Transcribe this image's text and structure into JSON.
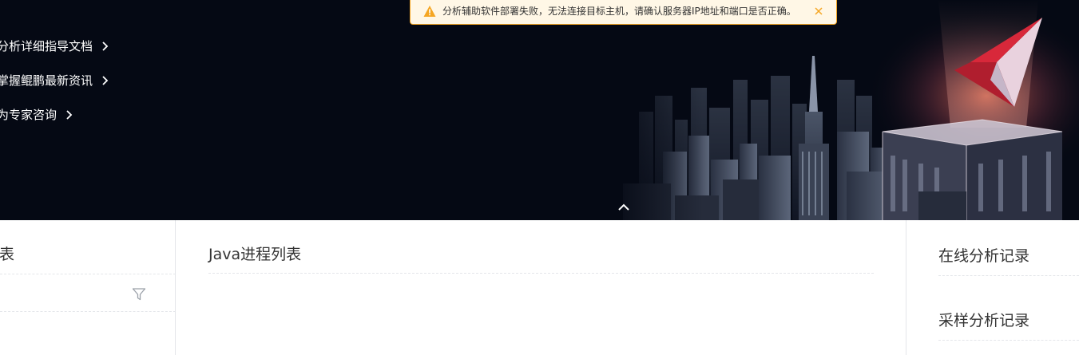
{
  "banner": {
    "links": [
      {
        "label": "分析详细指导文档"
      },
      {
        "label": "掌握鲲鹏最新资讯"
      },
      {
        "label": "为专家咨询"
      }
    ],
    "collapse_icon": "chevron-up-icon"
  },
  "alert": {
    "type": "warning",
    "message": "分析辅助软件部署失败，无法连接目标主机，请确认服务器IP地址和端口是否正确。",
    "icon": "warning-triangle-icon",
    "close_icon": "close-icon",
    "accent_color": "#f5a623"
  },
  "left_panel": {
    "title": "表",
    "filter_icon": "filter-icon"
  },
  "main_panel": {
    "title": "Java进程列表"
  },
  "right_panel": {
    "items": [
      {
        "label": "在线分析记录"
      },
      {
        "label": "采样分析记录"
      }
    ]
  }
}
